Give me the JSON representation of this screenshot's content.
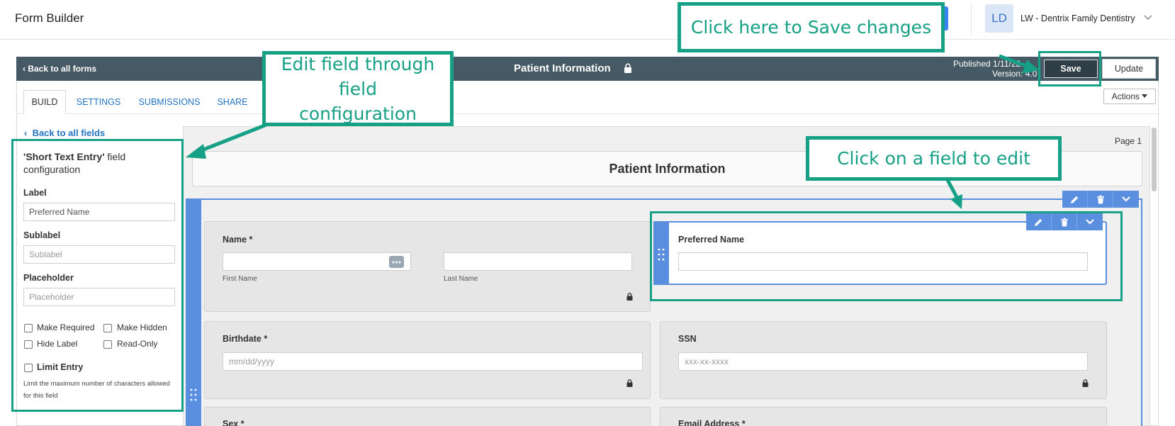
{
  "app": {
    "title": "Form Builder"
  },
  "account": {
    "initials": "LD",
    "name": "LW - Dentrix Family Dentistry",
    "menu_icon": "chevron-down-icon"
  },
  "toolbar": {
    "back_label": "Back to all forms",
    "form_title": "Patient Information",
    "published_text": "Published 1/11/22",
    "version_text": "Version: 4.0",
    "save_label": "Save",
    "update_label": "Update",
    "actions_label": "Actions"
  },
  "tabs": [
    {
      "label": "BUILD",
      "active": true
    },
    {
      "label": "SETTINGS",
      "active": false
    },
    {
      "label": "SUBMISSIONS",
      "active": false
    },
    {
      "label": "SHARE",
      "active": false
    }
  ],
  "config": {
    "back_label": "Back to all fields",
    "title_field": "'Short Text Entry'",
    "title_rest": "field configuration",
    "label_title": "Label",
    "label_value": "Preferred Name",
    "sublabel_title": "Sublabel",
    "sublabel_placeholder": "Sublabel",
    "placeholder_title": "Placeholder",
    "placeholder_placeholder": "Placeholder",
    "checkboxes": [
      "Make Required",
      "Make Hidden",
      "Hide Label",
      "Read-Only"
    ],
    "limit_label": "Limit Entry",
    "limit_desc": "Limit the maximum number of characters allowed for this field"
  },
  "canvas": {
    "page_label": "Page 1",
    "header_title": "Patient Information",
    "fields": {
      "name": {
        "label": "Name *",
        "first_sub": "First Name",
        "last_sub": "Last Name"
      },
      "preferred": {
        "label": "Preferred Name"
      },
      "birthdate": {
        "label": "Birthdate *",
        "placeholder": "mm/dd/yyyy"
      },
      "ssn": {
        "label": "SSN",
        "placeholder": "xxx-xx-xxxx"
      },
      "sex": {
        "label": "Sex *"
      },
      "email": {
        "label": "Email Address *"
      }
    }
  },
  "callouts": {
    "save": "Click here to Save changes",
    "edit_config": "Edit field through field configuration",
    "click_field": "Click on a field to edit"
  },
  "colors": {
    "teal": "#16a085",
    "accent_blue": "#5a8fe0",
    "toolbar_dark": "#455a64"
  }
}
